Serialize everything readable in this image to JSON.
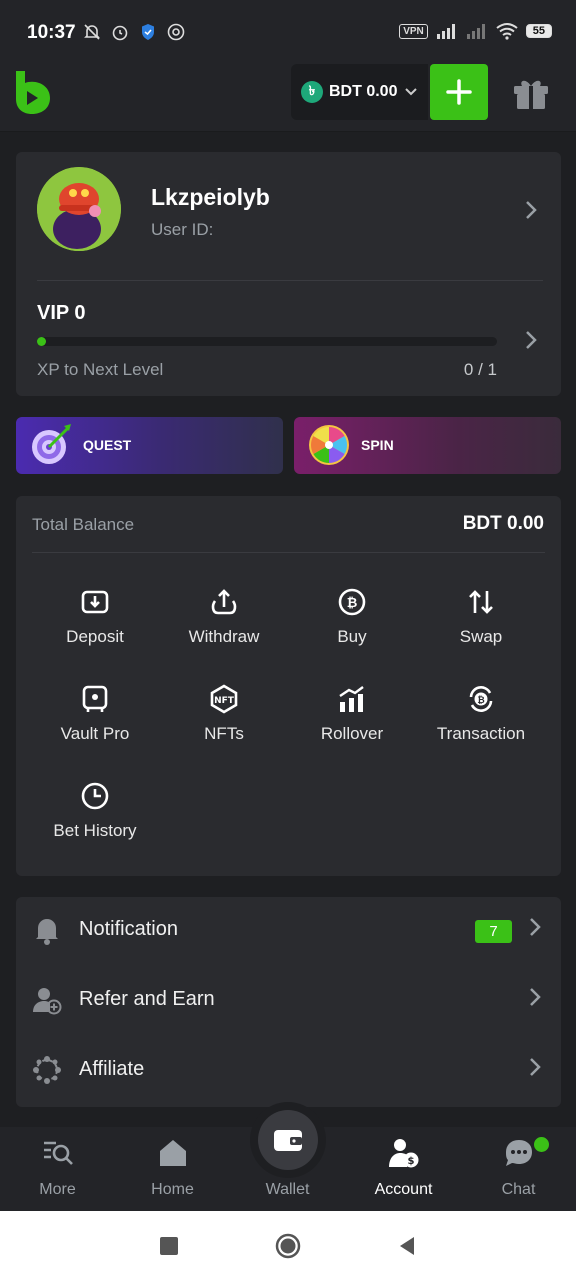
{
  "status_bar": {
    "time": "10:37",
    "vpn": "VPN",
    "battery": "55"
  },
  "header": {
    "balance": "BDT 0.00",
    "currency_symbol": "৳",
    "brand_color": "#3bc117"
  },
  "profile": {
    "username": "Lkzpeiolyb",
    "user_id_label": "User ID:",
    "vip_label": "VIP 0",
    "xp_label": "XP to Next Level",
    "xp_value": "0 / 1",
    "xp_progress": 0
  },
  "promos": {
    "quest_label": "QUEST",
    "spin_label": "SPIN"
  },
  "wallet": {
    "total_label": "Total Balance",
    "total_value": "BDT 0.00",
    "actions": [
      {
        "label": "Deposit",
        "icon": "deposit-icon"
      },
      {
        "label": "Withdraw",
        "icon": "withdraw-icon"
      },
      {
        "label": "Buy",
        "icon": "bitcoin-icon"
      },
      {
        "label": "Swap",
        "icon": "swap-icon"
      },
      {
        "label": "Vault Pro",
        "icon": "vault-icon"
      },
      {
        "label": "NFTs",
        "icon": "nft-icon"
      },
      {
        "label": "Rollover",
        "icon": "chart-icon"
      },
      {
        "label": "Transaction",
        "icon": "transaction-icon"
      },
      {
        "label": "Bet History",
        "icon": "clock-icon"
      }
    ]
  },
  "menu": {
    "items": [
      {
        "label": "Notification",
        "icon": "bell-icon",
        "badge": "7"
      },
      {
        "label": "Refer and Earn",
        "icon": "user-add-icon"
      },
      {
        "label": "Affiliate",
        "icon": "network-icon"
      }
    ]
  },
  "bottom_nav": {
    "items": [
      {
        "label": "More",
        "icon": "search-list-icon"
      },
      {
        "label": "Home",
        "icon": "home-icon"
      },
      {
        "label": "Wallet",
        "icon": "wallet-icon"
      },
      {
        "label": "Account",
        "icon": "account-icon",
        "active": true
      },
      {
        "label": "Chat",
        "icon": "chat-icon"
      }
    ]
  }
}
